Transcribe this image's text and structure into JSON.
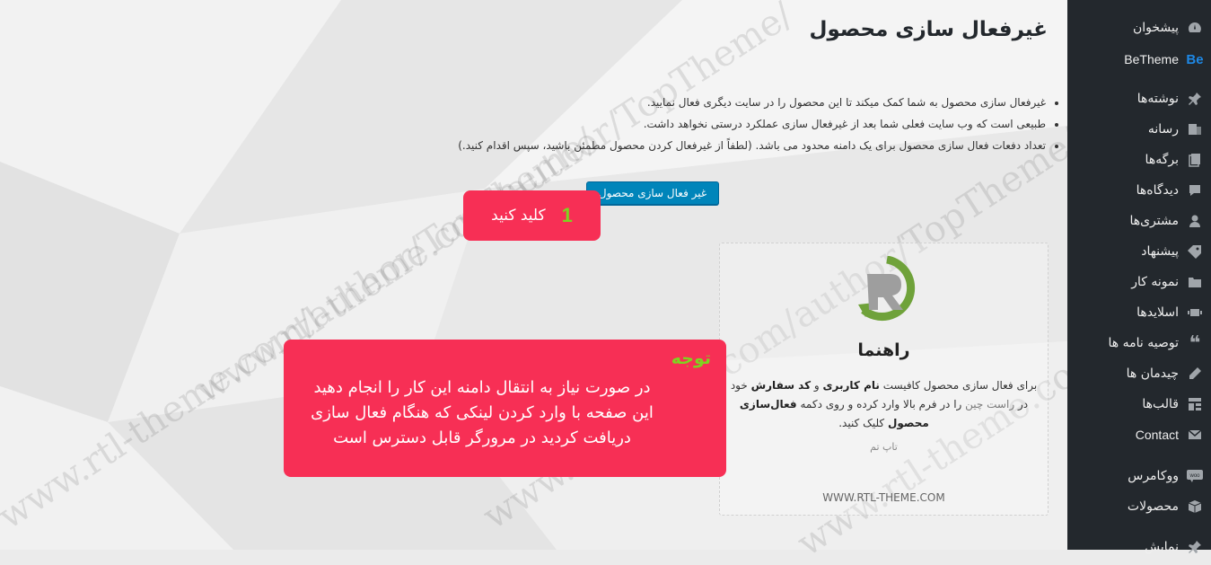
{
  "sidebar": {
    "items": [
      {
        "label": "پیشخوان",
        "icon": "dashboard-icon"
      },
      {
        "label": "BeTheme",
        "icon": "betheme-icon",
        "icon_text": "Be"
      },
      {
        "label": "نوشته‌ها",
        "icon": "pin-icon"
      },
      {
        "label": "رسانه",
        "icon": "media-icon"
      },
      {
        "label": "برگه‌ها",
        "icon": "pages-icon"
      },
      {
        "label": "دیدگاه‌ها",
        "icon": "comments-icon"
      },
      {
        "label": "مشتری‌ها",
        "icon": "clients-icon"
      },
      {
        "label": "پیشنهاد",
        "icon": "offer-icon"
      },
      {
        "label": "نمونه کار",
        "icon": "portfolio-icon"
      },
      {
        "label": "اسلایدها",
        "icon": "slides-icon"
      },
      {
        "label": "توصیه نامه ها",
        "icon": "quote-icon"
      },
      {
        "label": "چیدمان ها",
        "icon": "layouts-icon"
      },
      {
        "label": "قالب‌ها",
        "icon": "templates-icon"
      },
      {
        "label": "Contact",
        "icon": "mail-icon"
      },
      {
        "label": "ووکامرس",
        "icon": "woocommerce-icon"
      },
      {
        "label": "محصولات",
        "icon": "products-icon"
      },
      {
        "label": "نمایش",
        "icon": "appearance-icon"
      }
    ]
  },
  "main": {
    "title": "غیرفعال سازی محصول",
    "bullets": [
      "غیرفعال سازی محصول به شما کمک میکند تا این محصول را در سایت دیگری فعال نمایید.",
      "طبیعی است که وب سایت فعلی شما بعد از غیرفعال سازی عملکرد درستی نخواهد داشت.",
      "تعداد دفعات فعال سازی محصول برای یک دامنه محدود می باشد. (لطفاً از غیرفعال کردن محصول مطمئن باشید، سپس اقدام کنید.)"
    ],
    "deactivate_button": "غیر فعال سازی محصول"
  },
  "callout1": {
    "number": "1",
    "text": "کلید کنید"
  },
  "guide": {
    "title": "راهنما",
    "text_1": "برای فعال سازی محصول کافیست ",
    "bold_1": "نام کاربری",
    "text_2": " و ",
    "bold_2": "کد سفارش",
    "text_3": " خود در ",
    "link": "راست چین",
    "text_4": " را در فرم بالا وارد کرده و روی دکمه ",
    "bold_3": "فعال‌سازی محصول",
    "text_5": " کلیک کنید.",
    "brand": "تاپ تم",
    "url": "WWW.RTL-THEME.COM"
  },
  "callout2": {
    "heading": "توجه",
    "lines": [
      "در صورت نیاز به انتقال دامنه این کار را انجام دهید",
      "این صفحه با وارد کردن لینکی که هنگام فعال سازی",
      "دریافت کردید در مرورگر قابل دسترس است"
    ]
  },
  "watermarks": [
    "www.rtl-theme.com/author/TopTheme/",
    "www.rtl-theme.com/author/TopTheme/",
    "www.rtl-theme.com/author/TopTheme/",
    "www.rtl-theme.co"
  ],
  "colors": {
    "sidebar_bg": "#23282d",
    "primary_button": "#0085ba",
    "callout_bg": "#f72f55",
    "callout_accent": "#7ed321",
    "logo_green": "#6fa23a"
  }
}
